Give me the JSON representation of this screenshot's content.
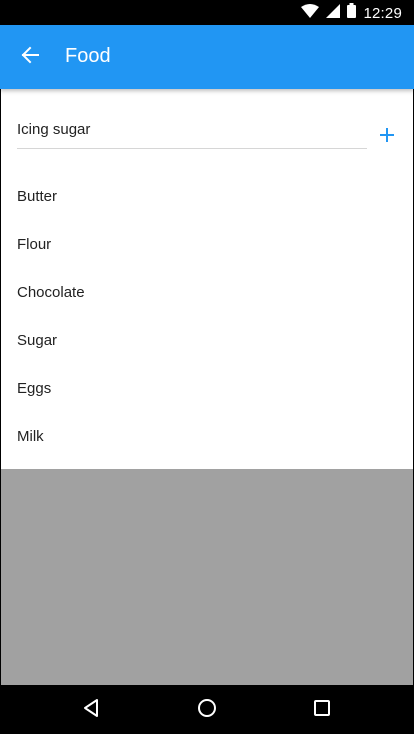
{
  "status_bar": {
    "time": "12:29",
    "icons": [
      "wifi-icon",
      "signal-icon",
      "battery-icon"
    ]
  },
  "app_bar": {
    "title": "Food",
    "back_icon": "arrow-back-icon",
    "color": "#2196f3"
  },
  "input": {
    "value": "Icing sugar",
    "add_icon": "plus-icon",
    "add_color": "#2196f3"
  },
  "items": [
    {
      "label": "Butter"
    },
    {
      "label": "Flour"
    },
    {
      "label": "Chocolate"
    },
    {
      "label": "Sugar"
    },
    {
      "label": "Eggs"
    },
    {
      "label": "Milk"
    }
  ],
  "nav_bar": {
    "icons": [
      "back-triangle-icon",
      "home-circle-icon",
      "recents-square-icon"
    ]
  }
}
